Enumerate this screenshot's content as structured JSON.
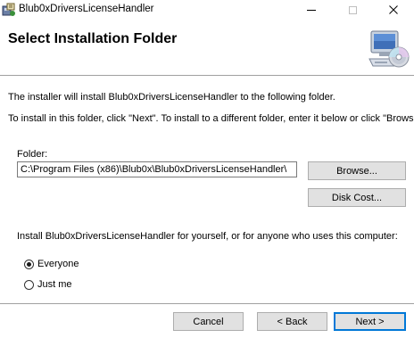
{
  "window": {
    "title": "Blub0xDriversLicenseHandler",
    "controls": {
      "minimize": "minimize",
      "maximize": "maximize",
      "close": "close"
    }
  },
  "header": {
    "title": "Select Installation Folder"
  },
  "body": {
    "intro_line1": "The installer will install Blub0xDriversLicenseHandler to the following folder.",
    "intro_line2": "To install in this folder, click \"Next\". To install to a different folder, enter it below or click \"Browse\".",
    "folder_label": "Folder:",
    "folder_value": "C:\\Program Files (x86)\\Blub0x\\Blub0xDriversLicenseHandler\\",
    "browse_label": "Browse...",
    "disk_cost_label": "Disk Cost...",
    "install_for_text": "Install Blub0xDriversLicenseHandler for yourself, or for anyone who uses this computer:",
    "radio_everyone": "Everyone",
    "radio_just_me": "Just me",
    "selected_option": "Everyone"
  },
  "footer": {
    "cancel_label": "Cancel",
    "back_label": "< Back",
    "next_label": "Next >"
  },
  "icons": {
    "app": "installer-icon",
    "header_art": "computer-disc-icon"
  },
  "colors": {
    "accent": "#0078d7",
    "button_face": "#e1e1e1",
    "separator": "#a0a0a0"
  }
}
